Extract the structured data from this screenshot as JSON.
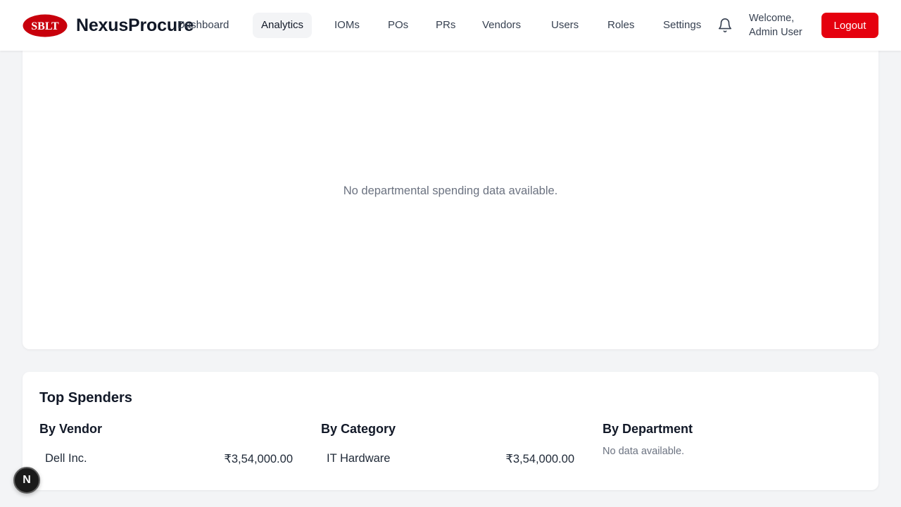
{
  "header": {
    "logo_text": "SBLT",
    "brand": "NexusProcure",
    "nav": [
      {
        "label": "Dashboard",
        "active": false
      },
      {
        "label": "Analytics",
        "active": true
      },
      {
        "label": "IOMs",
        "active": false
      },
      {
        "label": "POs",
        "active": false
      },
      {
        "label": "PRs",
        "active": false
      },
      {
        "label": "Vendors",
        "active": false
      },
      {
        "label": "Users",
        "active": false
      },
      {
        "label": "Roles",
        "active": false
      },
      {
        "label": "Settings",
        "active": false
      }
    ],
    "welcome_line1": "Welcome,",
    "welcome_line2": "Admin User",
    "logout_label": "Logout",
    "bell_icon": "bell-icon",
    "accent": "#e5000e"
  },
  "department_chart": {
    "empty_message": "No departmental spending data available."
  },
  "top_spenders": {
    "title": "Top Spenders",
    "by_vendor": {
      "title": "By Vendor",
      "rows": [
        {
          "label": "Dell Inc.",
          "value": "₹3,54,000.00"
        }
      ]
    },
    "by_category": {
      "title": "By Category",
      "rows": [
        {
          "label": "IT Hardware",
          "value": "₹3,54,000.00"
        }
      ]
    },
    "by_department": {
      "title": "By Department",
      "empty_message": "No data available."
    }
  },
  "dev_badge": "N"
}
